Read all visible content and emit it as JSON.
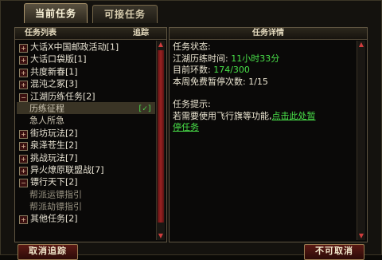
{
  "tabs": {
    "current": "当前任务",
    "available": "可接任务"
  },
  "left_header": {
    "title": "任务列表",
    "track": "追踪"
  },
  "right_header": {
    "title": "任务详情"
  },
  "list": [
    {
      "type": "group",
      "toggle": "+",
      "label": "大话X中国邮政活动[1]"
    },
    {
      "type": "group",
      "toggle": "+",
      "label": "大话口袋版[1]"
    },
    {
      "type": "group",
      "toggle": "+",
      "label": "共度新春[1]"
    },
    {
      "type": "group",
      "toggle": "+",
      "label": "混沌之冢[3]"
    },
    {
      "type": "group",
      "toggle": "−",
      "label": "江湖历练任务[2]"
    },
    {
      "type": "sub",
      "label": "历练征程",
      "selected": true,
      "track": "[✓]"
    },
    {
      "type": "sub",
      "label": "急人所急"
    },
    {
      "type": "group",
      "toggle": "+",
      "label": "街坊玩法[2]"
    },
    {
      "type": "group",
      "toggle": "+",
      "label": "泉泽苍生[2]"
    },
    {
      "type": "group",
      "toggle": "+",
      "label": "挑战玩法[7]"
    },
    {
      "type": "group",
      "toggle": "+",
      "label": "异火燎原联盟战[7]"
    },
    {
      "type": "group",
      "toggle": "−",
      "label": "镖行天下[2]"
    },
    {
      "type": "sub",
      "label": "帮派运镖指引",
      "dim": true
    },
    {
      "type": "sub",
      "label": "帮派劫镖指引",
      "dim": true
    },
    {
      "type": "group",
      "toggle": "+",
      "label": "其他任务[2]"
    }
  ],
  "details": {
    "status_label": "任务状态:",
    "time_label": "江湖历练时间:",
    "time_value": "11小时33分",
    "rings_label": "目前环数:",
    "rings_value": "174/300",
    "pause_label": "本周免费暂停次数:",
    "pause_value": "1/15",
    "hint_label": "任务提示:",
    "hint_text": "若需要使用飞行旗等功能,",
    "hint_link_1": "点击此处暂",
    "hint_link_2": "停任务"
  },
  "buttons": {
    "cancel_track": "取消追踪",
    "abandon": "不可取消"
  },
  "colors": {
    "accent_green": "#49e049",
    "panel_border": "#5f5541",
    "button_red": "#5b1a14"
  }
}
